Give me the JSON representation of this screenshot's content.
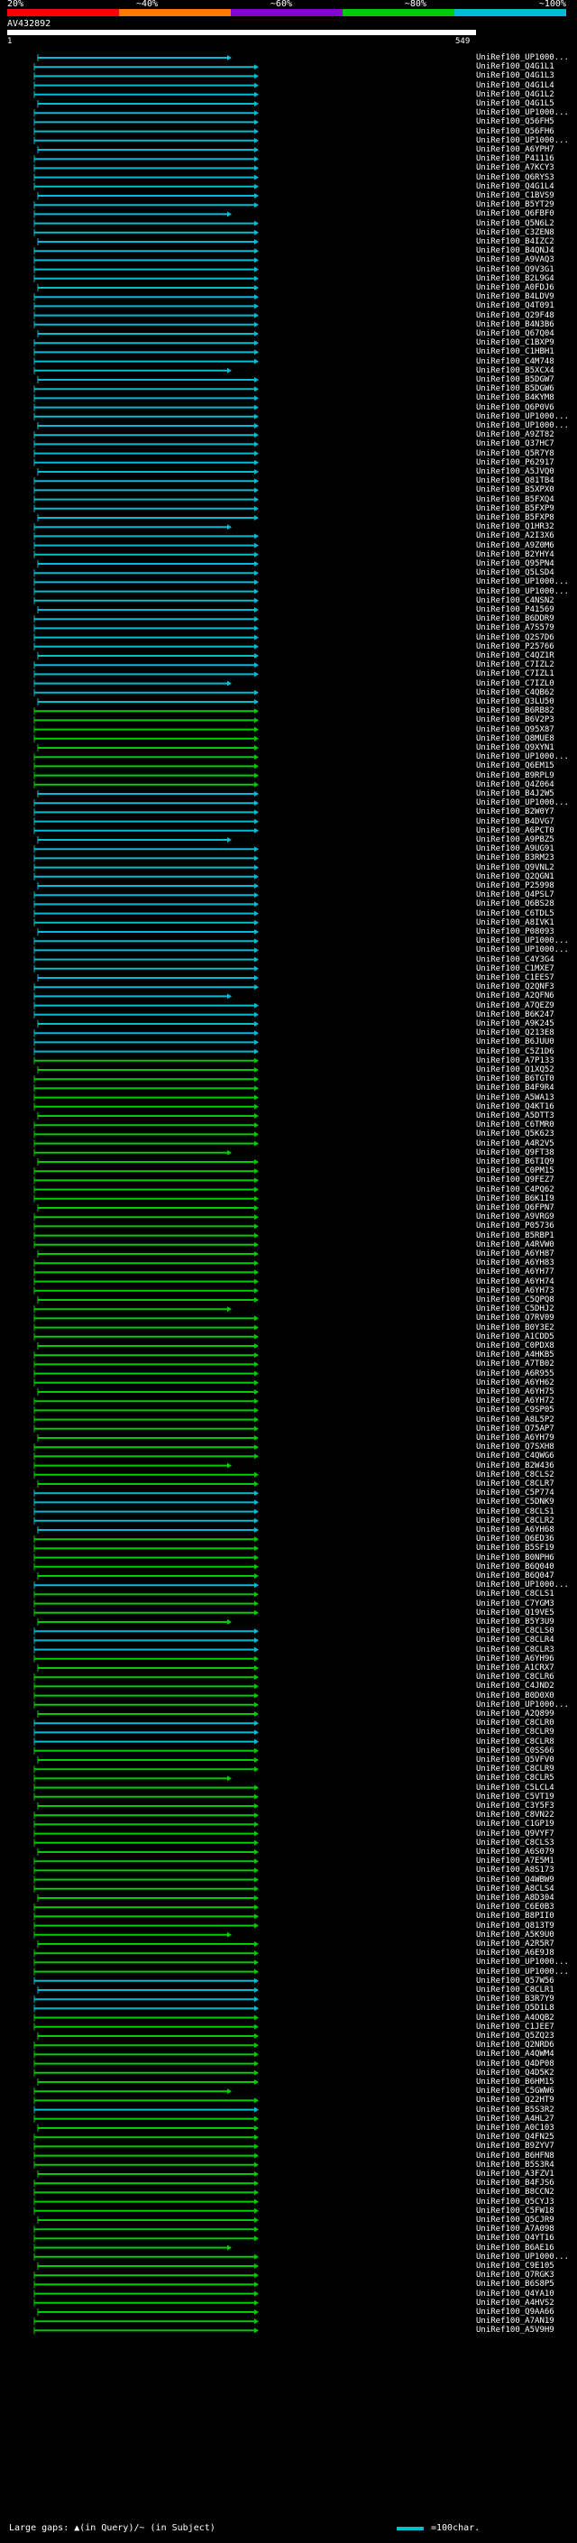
{
  "legend": {
    "labels": [
      "20%",
      "~40%",
      "~60%",
      "~80%",
      "~100%"
    ],
    "colors": [
      "#ff0000",
      "#ff7a00",
      "#8800cc",
      "#00cc00",
      "#00bcd4"
    ]
  },
  "query": {
    "title": "AV432892",
    "start": "1",
    "end": "549"
  },
  "footer": {
    "gaps_text": "Large gaps: ▲(in Query)/~ (in Subject)",
    "scale_text": "=100char."
  },
  "colors": {
    "high": "#00bcd4",
    "mid": "#00cc00",
    "background": "#000000",
    "text": "#ffffff"
  },
  "hits": [
    {
      "label": "UniRef100_UP1000...",
      "class": "h"
    },
    {
      "label": "UniRef100_Q4G1L1",
      "class": "h"
    },
    {
      "label": "UniRef100_Q4G1L3",
      "class": "h"
    },
    {
      "label": "UniRef100_Q4G1L4",
      "class": "h"
    },
    {
      "label": "UniRef100_Q4G1L2",
      "class": "h"
    },
    {
      "label": "UniRef100_Q4G1L5",
      "class": "h"
    },
    {
      "label": "UniRef100_UP1000...",
      "class": "h"
    },
    {
      "label": "UniRef100_Q56FH5",
      "class": "h"
    },
    {
      "label": "UniRef100_Q56FH6",
      "class": "h"
    },
    {
      "label": "UniRef100_UP1000...",
      "class": "h"
    },
    {
      "label": "UniRef100_A6YPH7",
      "class": "h"
    },
    {
      "label": "UniRef100_P41116",
      "class": "h"
    },
    {
      "label": "UniRef100_A7KCY3",
      "class": "h"
    },
    {
      "label": "UniRef100_Q6RYS3",
      "class": "h"
    },
    {
      "label": "UniRef100_Q4G1L4",
      "class": "h"
    },
    {
      "label": "UniRef100_C1BVS9",
      "class": "h"
    },
    {
      "label": "UniRef100_B5YT29",
      "class": "h"
    },
    {
      "label": "UniRef100_Q6FBF0",
      "class": "h"
    },
    {
      "label": "UniRef100_Q5N6L2",
      "class": "h"
    },
    {
      "label": "UniRef100_C3ZEN8",
      "class": "h"
    },
    {
      "label": "UniRef100_B4IZC2",
      "class": "h"
    },
    {
      "label": "UniRef100_B4QNJ4",
      "class": "h"
    },
    {
      "label": "UniRef100_A9VAQ3",
      "class": "h"
    },
    {
      "label": "UniRef100_Q9V3G1",
      "class": "h"
    },
    {
      "label": "UniRef100_B2L9G4",
      "class": "h"
    },
    {
      "label": "UniRef100_A0FDJ6",
      "class": "h"
    },
    {
      "label": "UniRef100_B4LDV9",
      "class": "h"
    },
    {
      "label": "UniRef100_Q4T091",
      "class": "h"
    },
    {
      "label": "UniRef100_Q29F48",
      "class": "h"
    },
    {
      "label": "UniRef100_B4N3B6",
      "class": "h"
    },
    {
      "label": "UniRef100_Q67Q04",
      "class": "h"
    },
    {
      "label": "UniRef100_C1BXP9",
      "class": "h"
    },
    {
      "label": "UniRef100_C1HBH1",
      "class": "h"
    },
    {
      "label": "UniRef100_C4M748",
      "class": "h"
    },
    {
      "label": "UniRef100_B5XCX4",
      "class": "h"
    },
    {
      "label": "UniRef100_B5DGW7",
      "class": "h"
    },
    {
      "label": "UniRef100_B5DGW6",
      "class": "h"
    },
    {
      "label": "UniRef100_B4KYM8",
      "class": "h"
    },
    {
      "label": "UniRef100_Q6P0V6",
      "class": "h"
    },
    {
      "label": "UniRef100_UP1000...",
      "class": "h"
    },
    {
      "label": "UniRef100_UP1000...",
      "class": "h"
    },
    {
      "label": "UniRef100_A9ZT82",
      "class": "h"
    },
    {
      "label": "UniRef100_Q37HC7",
      "class": "h"
    },
    {
      "label": "UniRef100_Q5R7Y8",
      "class": "h"
    },
    {
      "label": "UniRef100_P62917",
      "class": "h"
    },
    {
      "label": "UniRef100_A5JVQ0",
      "class": "h"
    },
    {
      "label": "UniRef100_Q81TB4",
      "class": "h"
    },
    {
      "label": "UniRef100_B5XPX0",
      "class": "h"
    },
    {
      "label": "UniRef100_B5FXQ4",
      "class": "h"
    },
    {
      "label": "UniRef100_B5FXP9",
      "class": "h"
    },
    {
      "label": "UniRef100_B5FXP8",
      "class": "h"
    },
    {
      "label": "UniRef100_Q1HR32",
      "class": "h"
    },
    {
      "label": "UniRef100_A2I3X6",
      "class": "h"
    },
    {
      "label": "UniRef100_A9Z0M6",
      "class": "h"
    },
    {
      "label": "UniRef100_B2YHY4",
      "class": "h"
    },
    {
      "label": "UniRef100_Q95PN4",
      "class": "h"
    },
    {
      "label": "UniRef100_Q5LSD4",
      "class": "h"
    },
    {
      "label": "UniRef100_UP1000...",
      "class": "h"
    },
    {
      "label": "UniRef100_UP1000...",
      "class": "h"
    },
    {
      "label": "UniRef100_C4NSN2",
      "class": "h"
    },
    {
      "label": "UniRef100_P41569",
      "class": "h"
    },
    {
      "label": "UniRef100_B6DDR9",
      "class": "h"
    },
    {
      "label": "UniRef100_A7S579",
      "class": "h"
    },
    {
      "label": "UniRef100_Q2S7D6",
      "class": "h"
    },
    {
      "label": "UniRef100_P25766",
      "class": "h"
    },
    {
      "label": "UniRef100_C4QZ1R",
      "class": "h"
    },
    {
      "label": "UniRef100_C7IZL2",
      "class": "h"
    },
    {
      "label": "UniRef100_C7IZL1",
      "class": "h"
    },
    {
      "label": "UniRef100_C7IZL0",
      "class": "h"
    },
    {
      "label": "UniRef100_C4QB62",
      "class": "h"
    },
    {
      "label": "UniRef100_Q3LU50",
      "class": "h"
    },
    {
      "label": "UniRef100_B6RB82",
      "class": "m"
    },
    {
      "label": "UniRef100_B6V2P3",
      "class": "m"
    },
    {
      "label": "UniRef100_Q95X87",
      "class": "m"
    },
    {
      "label": "UniRef100_Q8MUE8",
      "class": "m"
    },
    {
      "label": "UniRef100_Q9XYN1",
      "class": "m"
    },
    {
      "label": "UniRef100_UP1000...",
      "class": "m"
    },
    {
      "label": "UniRef100_Q6EM15",
      "class": "m"
    },
    {
      "label": "UniRef100_B9RPL9",
      "class": "m"
    },
    {
      "label": "UniRef100_Q4Z064",
      "class": "m"
    },
    {
      "label": "UniRef100_B4J2W5",
      "class": "h"
    },
    {
      "label": "UniRef100_UP1000...",
      "class": "h"
    },
    {
      "label": "UniRef100_B2W0Y7",
      "class": "h"
    },
    {
      "label": "UniRef100_B4DVG7",
      "class": "h"
    },
    {
      "label": "UniRef100_A6PCT0",
      "class": "h"
    },
    {
      "label": "UniRef100_A9PBZ5",
      "class": "h"
    },
    {
      "label": "UniRef100_A9UG91",
      "class": "h"
    },
    {
      "label": "UniRef100_B3RM23",
      "class": "h"
    },
    {
      "label": "UniRef100_Q9VNL2",
      "class": "h"
    },
    {
      "label": "UniRef100_Q2QGN1",
      "class": "h"
    },
    {
      "label": "UniRef100_P25998",
      "class": "h"
    },
    {
      "label": "UniRef100_Q4PSL7",
      "class": "h"
    },
    {
      "label": "UniRef100_Q6BS28",
      "class": "h"
    },
    {
      "label": "UniRef100_C6TDL5",
      "class": "h"
    },
    {
      "label": "UniRef100_A8IVK1",
      "class": "h"
    },
    {
      "label": "UniRef100_P08093",
      "class": "h"
    },
    {
      "label": "UniRef100_UP1000...",
      "class": "h"
    },
    {
      "label": "UniRef100_UP1000...",
      "class": "h"
    },
    {
      "label": "UniRef100_C4Y3G4",
      "class": "h"
    },
    {
      "label": "UniRef100_C1MXE7",
      "class": "h"
    },
    {
      "label": "UniRef100_C1EES7",
      "class": "h"
    },
    {
      "label": "UniRef100_Q2QNF3",
      "class": "h"
    },
    {
      "label": "UniRef100_A2QFN6",
      "class": "h"
    },
    {
      "label": "UniRef100_A7QEZ9",
      "class": "h"
    },
    {
      "label": "UniRef100_B6K247",
      "class": "h"
    },
    {
      "label": "UniRef100_A9K245",
      "class": "h"
    },
    {
      "label": "UniRef100_Q213E8",
      "class": "h"
    },
    {
      "label": "UniRef100_B6JUU0",
      "class": "h"
    },
    {
      "label": "UniRef100_C5Z1D6",
      "class": "h"
    },
    {
      "label": "UniRef100_A7P133",
      "class": "m"
    },
    {
      "label": "UniRef100_Q1XQ52",
      "class": "m"
    },
    {
      "label": "UniRef100_B6TGT0",
      "class": "m"
    },
    {
      "label": "UniRef100_B4F9R4",
      "class": "m"
    },
    {
      "label": "UniRef100_A5WA13",
      "class": "m"
    },
    {
      "label": "UniRef100_Q4KT16",
      "class": "m"
    },
    {
      "label": "UniRef100_A5DTT3",
      "class": "m"
    },
    {
      "label": "UniRef100_C6TMR0",
      "class": "m"
    },
    {
      "label": "UniRef100_Q5K623",
      "class": "m"
    },
    {
      "label": "UniRef100_A4R2V5",
      "class": "m"
    },
    {
      "label": "UniRef100_Q9FT38",
      "class": "m"
    },
    {
      "label": "UniRef100_B6TIQ9",
      "class": "m"
    },
    {
      "label": "UniRef100_C0PM15",
      "class": "m"
    },
    {
      "label": "UniRef100_Q9FEZ7",
      "class": "m"
    },
    {
      "label": "UniRef100_C4PQ62",
      "class": "m"
    },
    {
      "label": "UniRef100_B6K1I9",
      "class": "m"
    },
    {
      "label": "UniRef100_Q6FPN7",
      "class": "m"
    },
    {
      "label": "UniRef100_A9VRG9",
      "class": "m"
    },
    {
      "label": "UniRef100_P05736",
      "class": "m"
    },
    {
      "label": "UniRef100_B5RBP1",
      "class": "m"
    },
    {
      "label": "UniRef100_A4RVW0",
      "class": "m"
    },
    {
      "label": "UniRef100_A6YH87",
      "class": "m"
    },
    {
      "label": "UniRef100_A6YH83",
      "class": "m"
    },
    {
      "label": "UniRef100_A6YH77",
      "class": "m"
    },
    {
      "label": "UniRef100_A6YH74",
      "class": "m"
    },
    {
      "label": "UniRef100_A6YH73",
      "class": "m"
    },
    {
      "label": "UniRef100_C5QPQ8",
      "class": "m"
    },
    {
      "label": "UniRef100_C5DHJ2",
      "class": "m"
    },
    {
      "label": "UniRef100_Q7RV09",
      "class": "m"
    },
    {
      "label": "UniRef100_B0Y3E2",
      "class": "m"
    },
    {
      "label": "UniRef100_A1CDD5",
      "class": "m"
    },
    {
      "label": "UniRef100_C0PDX8",
      "class": "m"
    },
    {
      "label": "UniRef100_A4HKB5",
      "class": "m"
    },
    {
      "label": "UniRef100_A7TB02",
      "class": "m"
    },
    {
      "label": "UniRef100_A6R955",
      "class": "m"
    },
    {
      "label": "UniRef100_A6YH62",
      "class": "m"
    },
    {
      "label": "UniRef100_A6YH75",
      "class": "m"
    },
    {
      "label": "UniRef100_A6YH72",
      "class": "m"
    },
    {
      "label": "UniRef100_C9SP05",
      "class": "m"
    },
    {
      "label": "UniRef100_A8L5P2",
      "class": "m"
    },
    {
      "label": "UniRef100_Q75AP7",
      "class": "m"
    },
    {
      "label": "UniRef100_A6YH79",
      "class": "m"
    },
    {
      "label": "UniRef100_Q7SXH8",
      "class": "m"
    },
    {
      "label": "UniRef100_C4QWG6",
      "class": "m"
    },
    {
      "label": "UniRef100_B2W436",
      "class": "m"
    },
    {
      "label": "UniRef100_C8CLS2",
      "class": "m"
    },
    {
      "label": "UniRef100_C8CLR7",
      "class": "m"
    },
    {
      "label": "UniRef100_C5P774",
      "class": "h"
    },
    {
      "label": "UniRef100_C5DNK9",
      "class": "h"
    },
    {
      "label": "UniRef100_C8CLS1",
      "class": "h"
    },
    {
      "label": "UniRef100_C8CLR2",
      "class": "h"
    },
    {
      "label": "UniRef100_A6YH68",
      "class": "h"
    },
    {
      "label": "UniRef100_Q6ED36",
      "class": "m"
    },
    {
      "label": "UniRef100_B5SF19",
      "class": "m"
    },
    {
      "label": "UniRef100_B0NPH6",
      "class": "m"
    },
    {
      "label": "UniRef100_B6Q040",
      "class": "m"
    },
    {
      "label": "UniRef100_B6Q047",
      "class": "m"
    },
    {
      "label": "UniRef100_UP1000...",
      "class": "h"
    },
    {
      "label": "UniRef100_C8CLS1",
      "class": "m"
    },
    {
      "label": "UniRef100_C7YGM3",
      "class": "m"
    },
    {
      "label": "UniRef100_Q19VE5",
      "class": "m"
    },
    {
      "label": "UniRef100_B5Y3U9",
      "class": "m"
    },
    {
      "label": "UniRef100_C8CLS0",
      "class": "h"
    },
    {
      "label": "UniRef100_C8CLR4",
      "class": "h"
    },
    {
      "label": "UniRef100_C8CLR3",
      "class": "h"
    },
    {
      "label": "UniRef100_A6YH96",
      "class": "m"
    },
    {
      "label": "UniRef100_A1CRX7",
      "class": "m"
    },
    {
      "label": "UniRef100_C8CLR6",
      "class": "m"
    },
    {
      "label": "UniRef100_C4JND2",
      "class": "m"
    },
    {
      "label": "UniRef100_B0D0X0",
      "class": "m"
    },
    {
      "label": "UniRef100_UP1000...",
      "class": "m"
    },
    {
      "label": "UniRef100_A2Q899",
      "class": "m"
    },
    {
      "label": "UniRef100_C8CLR0",
      "class": "h"
    },
    {
      "label": "UniRef100_C8CLR9",
      "class": "h"
    },
    {
      "label": "UniRef100_C8CLR8",
      "class": "h"
    },
    {
      "label": "UniRef100_C0SS66",
      "class": "m"
    },
    {
      "label": "UniRef100_Q5VFV0",
      "class": "m"
    },
    {
      "label": "UniRef100_C8CLR9",
      "class": "m"
    },
    {
      "label": "UniRef100_C8CLR5",
      "class": "m"
    },
    {
      "label": "UniRef100_C5LCL4",
      "class": "m"
    },
    {
      "label": "UniRef100_C5VT19",
      "class": "m"
    },
    {
      "label": "UniRef100_C3Y5F3",
      "class": "m"
    },
    {
      "label": "UniRef100_C8VN22",
      "class": "m"
    },
    {
      "label": "UniRef100_C1GP19",
      "class": "m"
    },
    {
      "label": "UniRef100_Q9VYF7",
      "class": "m"
    },
    {
      "label": "UniRef100_C8CLS3",
      "class": "m"
    },
    {
      "label": "UniRef100_A6S079",
      "class": "m"
    },
    {
      "label": "UniRef100_A7E5M1",
      "class": "m"
    },
    {
      "label": "UniRef100_A8S173",
      "class": "m"
    },
    {
      "label": "UniRef100_Q4WBW9",
      "class": "m"
    },
    {
      "label": "UniRef100_A8CLS4",
      "class": "m"
    },
    {
      "label": "UniRef100_A8D304",
      "class": "m"
    },
    {
      "label": "UniRef100_C6E0B3",
      "class": "m"
    },
    {
      "label": "UniRef100_B8PII0",
      "class": "m"
    },
    {
      "label": "UniRef100_Q813T9",
      "class": "m"
    },
    {
      "label": "UniRef100_A5K9U0",
      "class": "m"
    },
    {
      "label": "UniRef100_A2R5R7",
      "class": "m"
    },
    {
      "label": "UniRef100_A6E9J8",
      "class": "m"
    },
    {
      "label": "UniRef100_UP1000...",
      "class": "m"
    },
    {
      "label": "UniRef100_UP1000...",
      "class": "m"
    },
    {
      "label": "UniRef100_Q57W56",
      "class": "h"
    },
    {
      "label": "UniRef100_C8CLR1",
      "class": "h"
    },
    {
      "label": "UniRef100_B3R7Y9",
      "class": "h"
    },
    {
      "label": "UniRef100_Q5D1L8",
      "class": "h"
    },
    {
      "label": "UniRef100_A4OQB2",
      "class": "m"
    },
    {
      "label": "UniRef100_C1JEE7",
      "class": "m"
    },
    {
      "label": "UniRef100_Q5ZQ23",
      "class": "m"
    },
    {
      "label": "UniRef100_Q2NRD6",
      "class": "m"
    },
    {
      "label": "UniRef100_A4QWM4",
      "class": "m"
    },
    {
      "label": "UniRef100_Q4DP08",
      "class": "m"
    },
    {
      "label": "UniRef100_Q4D5K2",
      "class": "m"
    },
    {
      "label": "UniRef100_B6HM15",
      "class": "m"
    },
    {
      "label": "UniRef100_C5GWW6",
      "class": "m"
    },
    {
      "label": "UniRef100_Q22HT9",
      "class": "m"
    },
    {
      "label": "UniRef100_B5S3R2",
      "class": "h"
    },
    {
      "label": "UniRef100_A4HL27",
      "class": "m"
    },
    {
      "label": "UniRef100_A0C103",
      "class": "m"
    },
    {
      "label": "UniRef100_Q4FN25",
      "class": "m"
    },
    {
      "label": "UniRef100_B9ZYV7",
      "class": "m"
    },
    {
      "label": "UniRef100_B6HFN8",
      "class": "m"
    },
    {
      "label": "UniRef100_B5S3R4",
      "class": "m"
    },
    {
      "label": "UniRef100_A3FZV1",
      "class": "m"
    },
    {
      "label": "UniRef100_B4FJS6",
      "class": "m"
    },
    {
      "label": "UniRef100_B8CCN2",
      "class": "m"
    },
    {
      "label": "UniRef100_Q5CYJ3",
      "class": "m"
    },
    {
      "label": "UniRef100_C5FW18",
      "class": "m"
    },
    {
      "label": "UniRef100_Q5CJR9",
      "class": "m"
    },
    {
      "label": "UniRef100_A7A098",
      "class": "m"
    },
    {
      "label": "UniRef100_Q4YT16",
      "class": "m"
    },
    {
      "label": "UniRef100_B6AE16",
      "class": "m"
    },
    {
      "label": "UniRef100_UP1000...",
      "class": "m"
    },
    {
      "label": "UniRef100_C9E105",
      "class": "m"
    },
    {
      "label": "UniRef100_Q7RGK3",
      "class": "m"
    },
    {
      "label": "UniRef100_B6S8P5",
      "class": "m"
    },
    {
      "label": "UniRef100_Q4YA10",
      "class": "m"
    },
    {
      "label": "UniRef100_A4HVS2",
      "class": "m"
    },
    {
      "label": "UniRef100_Q9AA66",
      "class": "m"
    },
    {
      "label": "UniRef100_A7AN19",
      "class": "m"
    },
    {
      "label": "UniRef100_A5V9H9",
      "class": "m"
    }
  ]
}
